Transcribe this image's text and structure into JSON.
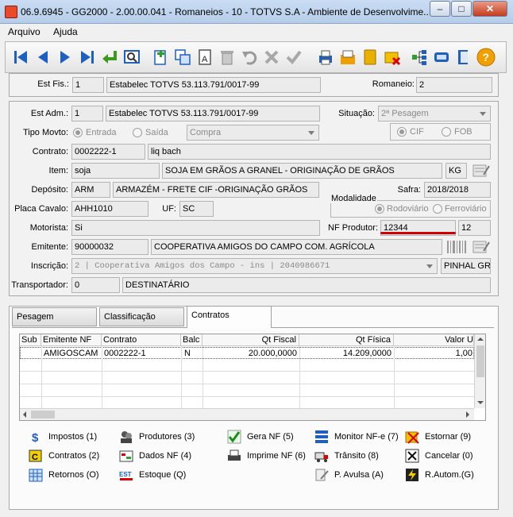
{
  "window": {
    "title": "06.9.6945 - GG2000 - 2.00.00.041 - Romaneios - 10 - TOTVS S.A - Ambiente de Desenvolvime..."
  },
  "menu": {
    "arquivo": "Arquivo",
    "ajuda": "Ajuda"
  },
  "header": {
    "est_fis_label": "Est Fis.:",
    "est_fis_code": "1",
    "est_fis_name": "Estabelec TOTVS 53.113.791/0017-99",
    "romaneio_label": "Romaneio:",
    "romaneio_value": "2"
  },
  "form": {
    "est_adm_label": "Est Adm.:",
    "est_adm_code": "1",
    "est_adm_name": "Estabelec TOTVS 53.113.791/0017-99",
    "situacao_label": "Situação:",
    "situacao_value": "2ª Pesagem",
    "tipo_movto_label": "Tipo Movto:",
    "entrada": "Entrada",
    "saida": "Saída",
    "compra": "Compra",
    "cif": "CIF",
    "fob": "FOB",
    "contrato_label": "Contrato:",
    "contrato_value": "0002222-1",
    "contrato_desc": "liq bach",
    "item_label": "Item:",
    "item_code": "soja",
    "item_desc": "SOJA EM GRÃOS A GRANEL - ORIGINAÇÃO DE GRÃOS",
    "item_un": "KG",
    "deposito_label": "Depósito:",
    "deposito_code": "ARM",
    "deposito_desc": "ARMAZÉM - FRETE CIF -ORIGINAÇÃO GRÃOS",
    "safra_label": "Safra:",
    "safra_value": "2018/2018",
    "placa_label": "Placa Cavalo:",
    "placa_value": "AHH1010",
    "uf_label": "UF:",
    "uf_value": "SC",
    "modalidade_label": "Modalidade",
    "rodoviario": "Rodoviário",
    "ferroviario": "Ferroviário",
    "motorista_label": "Motorista:",
    "motorista_value": "Si",
    "nf_produtor_label": "NF Produtor:",
    "nf_produtor_value": "12344",
    "nf_serie": "12",
    "emitente_label": "Emitente:",
    "emitente_code": "90000032",
    "emitente_name": "COOPERATIVA AMIGOS DO CAMPO COM. AGRÍCOLA",
    "inscricao_label": "Inscrição:",
    "inscricao_value": "2 | Cooperativa Amigos dos Campo - ins | 2040986671",
    "inscricao_city": "PINHAL GRA",
    "transportador_label": "Transportador:",
    "transportador_code": "0",
    "transportador_name": "DESTINATÁRIO"
  },
  "tabs": [
    {
      "label": "Pesagem"
    },
    {
      "label": "Classificação"
    },
    {
      "label": "Contratos"
    }
  ],
  "grid": {
    "columns": [
      "Sub",
      "Emitente NF",
      "Contrato",
      "Balc",
      "Qt Fiscal",
      "Qt Física",
      "Valor U"
    ],
    "rows": [
      [
        "",
        "AMIGOSCAM",
        "0002222-1",
        "N",
        "20.000,0000",
        "14.209,0000",
        "1,00"
      ]
    ]
  },
  "actions": {
    "impostos": "Impostos (1)",
    "produtores": "Produtores (3)",
    "gera_nf": "Gera NF (5)",
    "monitor_nfe": "Monitor NF-e (7)",
    "estornar": "Estornar (9)",
    "contratos": "Contratos (2)",
    "dados_nf": "Dados NF (4)",
    "imprime_nf": "Imprime NF (6)",
    "transito": "Trânsito (8)",
    "cancelar": "Cancelar (0)",
    "retornos": "Retornos (O)",
    "estoque": "Estoque (Q)",
    "p_avulsa": "P. Avulsa (A)",
    "r_autom": "R.Autom.(G)"
  },
  "colors": {
    "toolbar_blue": "#1f5fbf",
    "highlight_red": "#d00000",
    "help_orange": "#f2a000"
  }
}
